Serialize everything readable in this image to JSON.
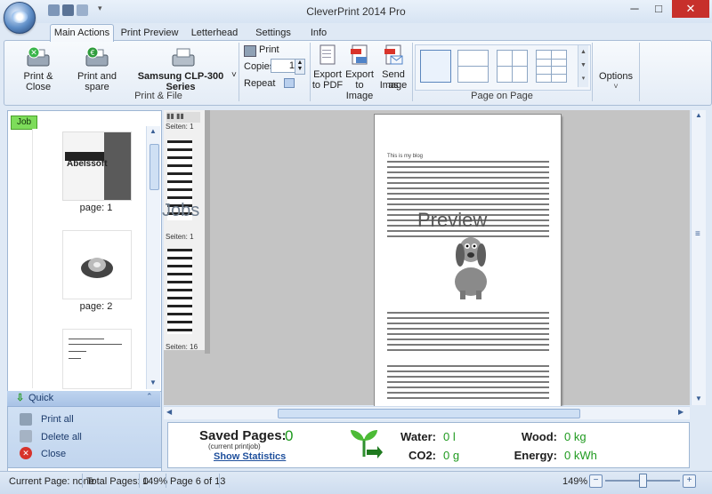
{
  "window": {
    "title": "CleverPrint 2014 Pro",
    "minimize": "─",
    "maximize": "□",
    "close": "✕"
  },
  "tabs": [
    "Main Actions",
    "Print Preview",
    "Letterhead",
    "Settings",
    "Info"
  ],
  "ribbon": {
    "print_close": "Print & Close",
    "print_spare": "Print and spare",
    "printer_name": "Samsung CLP-300 Series",
    "printer_arrow": "˅",
    "print_label": "Print",
    "copies_label": "Copies",
    "copies_value": "1",
    "repeat_label": "Repeat",
    "group_print_file": "Print & File",
    "export_pdf": [
      "Export",
      "to PDF"
    ],
    "export_image": [
      "Export",
      "to Image"
    ],
    "send_image": [
      "Send as",
      "Image"
    ],
    "group_page_on_page": "Page on Page",
    "options": "Options",
    "options_arrow": "˅"
  },
  "left_panel": {
    "job_tab": "Job",
    "thumbnails": [
      {
        "caption": "page: 1",
        "logo_text": "Abelssoft"
      },
      {
        "caption": "page: 2"
      }
    ]
  },
  "quick": {
    "header": "Quick",
    "items": [
      "Print all",
      "Delete all",
      "Close"
    ]
  },
  "preview": {
    "bg_label": "Jobs",
    "seiten_1": "Seiten: 1",
    "seiten_1b": "Seiten: 1",
    "seiten_16": "Seiten: 16",
    "heading": "This is my blog",
    "watermark": "Preview"
  },
  "stats": {
    "saved_pages_label": "Saved Pages:",
    "saved_pages_value": "0",
    "current_printjob": "(current printjob)",
    "show_statistics": "Show Statistics",
    "water_label": "Water:",
    "water_value": "0 l",
    "co2_label": "CO2:",
    "co2_value": "0 g",
    "wood_label": "Wood:",
    "wood_value": "0 kg",
    "energy_label": "Energy:",
    "energy_value": "0 kWh"
  },
  "statusbar": {
    "current_page": "Current Page: none",
    "total_pages": "Total Pages: 0",
    "zoom_pct": "149%",
    "page_of": "Page 6 of 13",
    "zoom_right": "149%"
  },
  "colors": {
    "accent": "#1f9a1f",
    "close_red": "#c7302b",
    "ribbon_border": "#a9bdd6"
  }
}
